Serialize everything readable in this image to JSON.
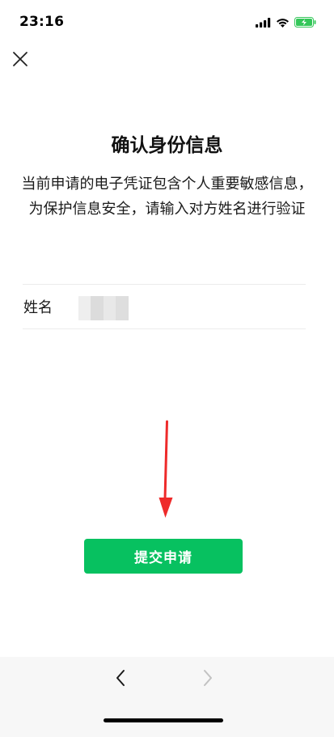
{
  "status_bar": {
    "time": "23:16",
    "icons": [
      "cellular-signal-icon",
      "wifi-icon",
      "battery-charging-icon"
    ]
  },
  "header": {
    "close_icon": "close-icon"
  },
  "title": "确认身份信息",
  "description": "当前申请的电子凭证包含个人重要敏感信息，为保护信息安全，请输入对方姓名进行验证",
  "form": {
    "name_label": "姓名",
    "name_value_state": "blurred"
  },
  "annotation": {
    "arrow_color": "#ee2a2a",
    "arrow_icon": "down-arrow-icon"
  },
  "submit_button": {
    "label": "提交申请",
    "color": "#07c160"
  },
  "bottom_bar": {
    "back_icon": "chevron-left-icon",
    "forward_icon": "chevron-right-icon",
    "forward_enabled": false
  }
}
